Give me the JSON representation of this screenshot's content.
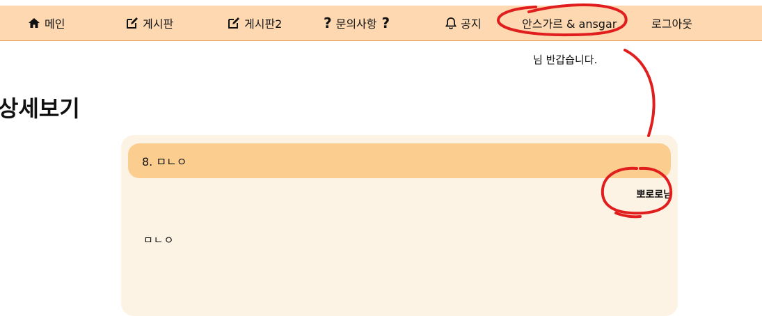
{
  "nav": {
    "home": "메인",
    "board": "게시판",
    "board2": "게시판2",
    "inquiry": "문의사항",
    "inquiry_mark": "?",
    "notice": "공지",
    "user": "안스가르 & ansgar",
    "logout": "로그아웃"
  },
  "greeting": "님 반갑습니다.",
  "page_title": "상세보기",
  "post": {
    "header": "8. ㅁㄴㅇ",
    "author": "뽀로로님",
    "content": "ㅁㄴㅇ"
  },
  "colors": {
    "nav_bg": "#fdd8b0",
    "card_bg": "#fdf3e4",
    "header_bg": "#fbcd8e",
    "annotation": "#e01e1e"
  },
  "icons": [
    "home-icon",
    "edit-icon",
    "question-icon",
    "bell-icon"
  ]
}
